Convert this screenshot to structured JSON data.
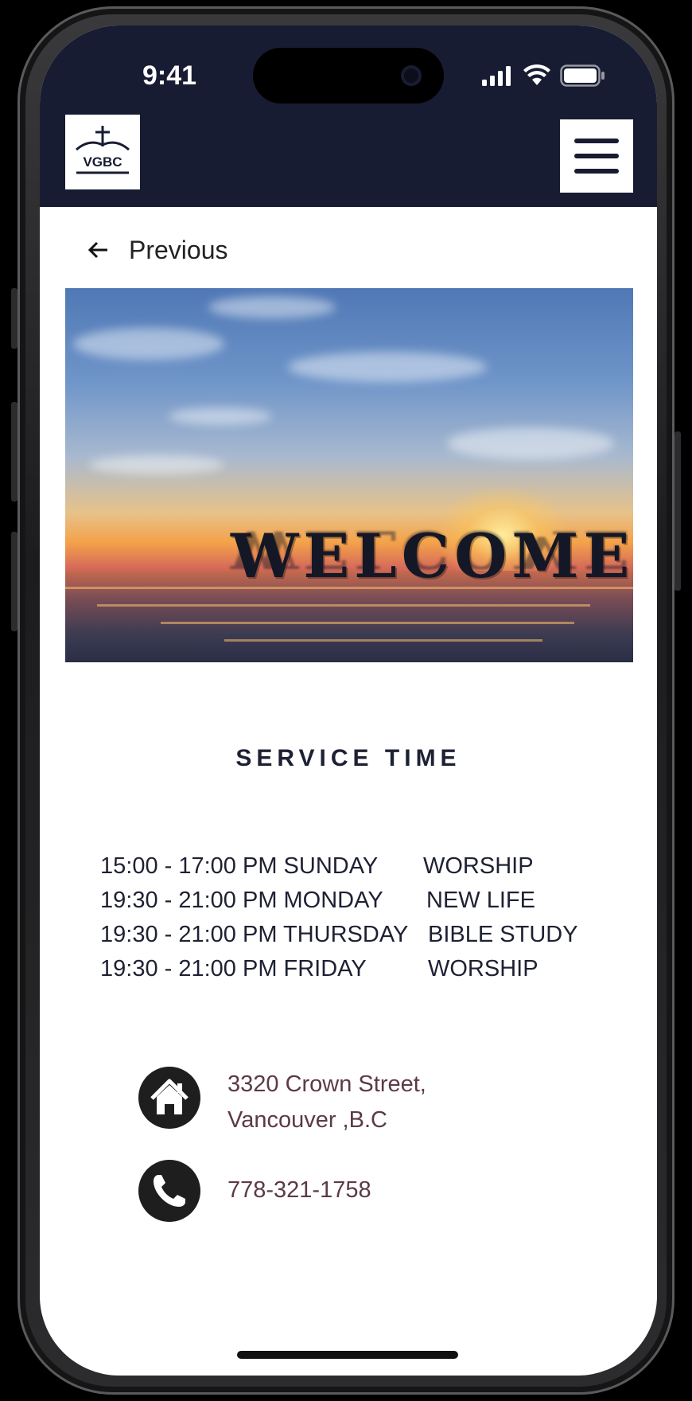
{
  "status_bar": {
    "time": "9:41"
  },
  "header": {
    "logo_text": "VGBC",
    "background_color": "#181c32"
  },
  "navigation": {
    "back_label": "Previous"
  },
  "hero": {
    "banner_text": "WELCOME"
  },
  "service_time": {
    "title": "SERVICE TIME",
    "rows": [
      {
        "time": "15:00 - 17:00 PM SUNDAY",
        "event": "WORSHIP"
      },
      {
        "time": "19:30 - 21:00 PM MONDAY",
        "event": "NEW LIFE"
      },
      {
        "time": "19:30 - 21:00 PM THURSDAY",
        "event": "BIBLE STUDY"
      },
      {
        "time": "19:30 - 21:00 PM FRIDAY",
        "event": "WORSHIP"
      }
    ]
  },
  "contact": {
    "address_line1": "3320 Crown Street,",
    "address_line2": "Vancouver ,B.C",
    "phone": "778-321-1758",
    "text_color": "#5c3a46"
  },
  "icons": {
    "address": "home-icon",
    "phone": "phone-icon",
    "menu": "hamburger-menu-icon",
    "back": "arrow-left-icon"
  }
}
